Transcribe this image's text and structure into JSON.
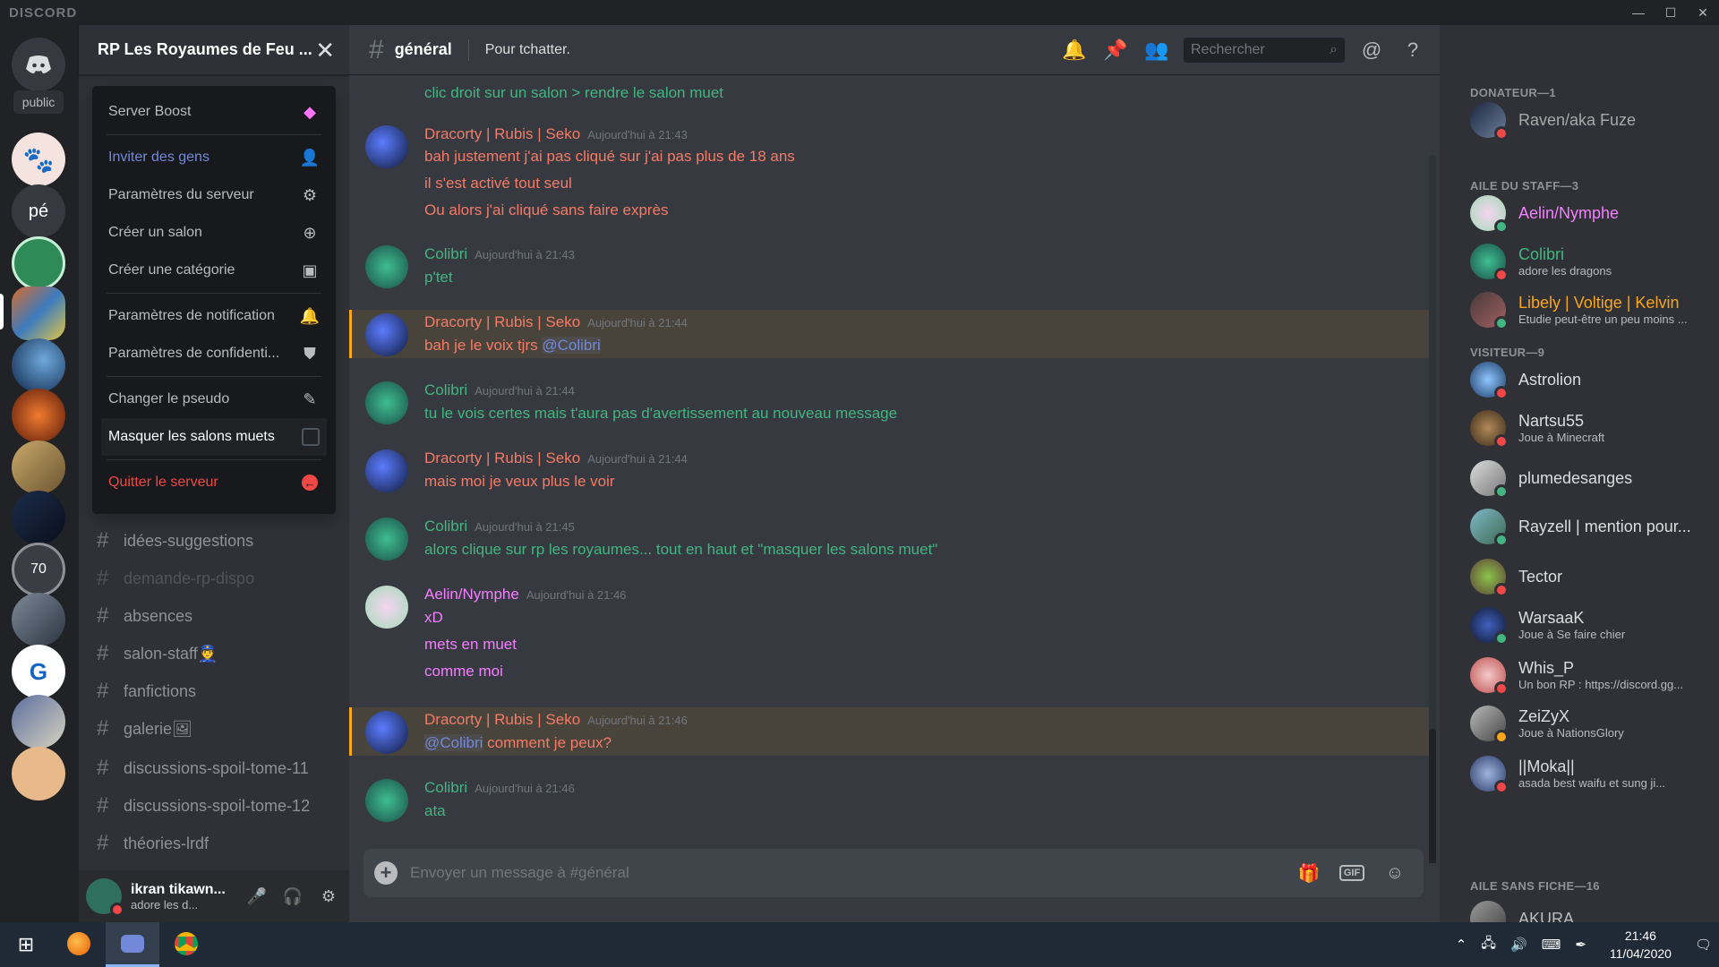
{
  "app": {
    "brand": "DISCORD"
  },
  "rail": {
    "folder_label": "public",
    "pe_label": "pé",
    "level_label": "70"
  },
  "guild": {
    "name": "RP Les Royaumes de Feu ..."
  },
  "menu": {
    "items": [
      {
        "label": "Server Boost",
        "icon": "boost-icon"
      },
      {
        "label": "Inviter des gens",
        "icon": "add-user-icon"
      },
      {
        "label": "Paramètres du serveur",
        "icon": "gear-icon"
      },
      {
        "label": "Créer un salon",
        "icon": "plus-circle-icon"
      },
      {
        "label": "Créer une catégorie",
        "icon": "folder-plus-icon"
      },
      {
        "label": "Paramètres de notification",
        "icon": "bell-icon"
      },
      {
        "label": "Paramètres de confidenti...",
        "icon": "shield-icon"
      },
      {
        "label": "Changer le pseudo",
        "icon": "pencil-icon"
      },
      {
        "label": "Masquer les salons muets",
        "icon": "checkbox-icon"
      },
      {
        "label": "Quitter le serveur",
        "icon": "leave-icon"
      }
    ]
  },
  "channels": [
    {
      "name": "idées-suggestions"
    },
    {
      "name": "demande-rp-dispo"
    },
    {
      "name": "absences"
    },
    {
      "name": "salon-staff👮"
    },
    {
      "name": "fanfictions"
    },
    {
      "name": "galerie🖼"
    },
    {
      "name": "discussions-spoil-tome-11"
    },
    {
      "name": "discussions-spoil-tome-12"
    },
    {
      "name": "théories-lrdf"
    }
  ],
  "user": {
    "name": "ikran tikawn...",
    "status": "adore les d..."
  },
  "chat": {
    "channel": "général",
    "topic": "Pour tchatter.",
    "search_placeholder": "Rechercher",
    "composer_placeholder": "Envoyer un message à #général",
    "gif_label": "GIF"
  },
  "messages": [
    {
      "author": "",
      "time": "",
      "lines": [
        "clic droit sur un salon > rendre le salon muet"
      ],
      "color": "#43b581"
    },
    {
      "author": "Dracorty | Rubis | Seko",
      "time": "Aujourd'hui à 21:43",
      "lines": [
        "bah justement j'ai pas cliqué sur j'ai pas plus de 18 ans",
        "il s'est activé tout seul",
        "Ou alors j'ai cliqué sans faire exprès"
      ],
      "color": "#f47b67"
    },
    {
      "author": "Colibri",
      "time": "Aujourd'hui à 21:43",
      "lines": [
        "p'tet"
      ],
      "color": "#43b581"
    },
    {
      "author": "Dracorty | Rubis | Seko",
      "time": "Aujourd'hui à 21:44",
      "lines_pre": "bah je le voix tjrs ",
      "mention": "@Colibri",
      "color": "#f47b67"
    },
    {
      "author": "Colibri",
      "time": "Aujourd'hui à 21:44",
      "lines": [
        "tu le vois certes mais t'aura pas d'avertissement au nouveau message"
      ],
      "color": "#43b581"
    },
    {
      "author": "Dracorty | Rubis | Seko",
      "time": "Aujourd'hui à 21:44",
      "lines": [
        "mais moi je veux plus le voir"
      ],
      "color": "#f47b67"
    },
    {
      "author": "Colibri",
      "time": "Aujourd'hui à 21:45",
      "lines": [
        "alors clique sur rp les royaumes... tout en haut et \"masquer les salons muet\""
      ],
      "color": "#43b581"
    },
    {
      "author": "Aelin/Nymphe",
      "time": "Aujourd'hui à 21:46",
      "lines": [
        "xD",
        "mets en muet",
        "comme moi"
      ],
      "color": "#f47fff"
    },
    {
      "author": "Dracorty | Rubis | Seko",
      "time": "Aujourd'hui à 21:46",
      "mention": "@Colibri",
      "lines_post": " comment je peux?",
      "color": "#f47b67"
    },
    {
      "author": "Colibri",
      "time": "Aujourd'hui à 21:46",
      "lines": [
        "ata"
      ],
      "color": "#43b581"
    }
  ],
  "members": {
    "groups": [
      "DONATEUR—1",
      "AILE DU STAFF—3",
      "VISITEUR—9",
      "AILE SANS FICHE—16"
    ],
    "list": [
      {
        "name": "Raven/aka Fuze",
        "activity": "",
        "color": "#a9a9a9",
        "status": "#f04747"
      },
      {
        "name": "Aelin/Nymphe",
        "activity": "",
        "color": "#f47fff",
        "status": "#43b581"
      },
      {
        "name": "Colibri",
        "activity": "adore les dragons",
        "color": "#43b581",
        "status": "#f04747"
      },
      {
        "name": "Libely | Voltige | Kelvin",
        "activity": "Etudie peut-être un peu moins ...",
        "color": "#faa61a",
        "status": "#43b581"
      },
      {
        "name": "Astrolion",
        "activity": "",
        "color": "#ffffff",
        "status": "#f04747"
      },
      {
        "name": "Nartsu55",
        "activity": "Joue à Minecraft",
        "color": "#ffffff",
        "status": "#f04747"
      },
      {
        "name": "plumedesanges",
        "activity": "",
        "color": "#ffffff",
        "status": "#43b581"
      },
      {
        "name": "Rayzell | mention pour...",
        "activity": "",
        "color": "#ffffff",
        "status": "#43b581"
      },
      {
        "name": "Tector",
        "activity": "",
        "color": "#ffffff",
        "status": "#f04747"
      },
      {
        "name": "WarsaaK",
        "activity": "Joue à Se faire chier",
        "color": "#ffffff",
        "status": "#43b581"
      },
      {
        "name": "Whis_P",
        "activity": "Un bon RP : https://discord.gg...",
        "color": "#ffffff",
        "status": "#f04747"
      },
      {
        "name": "ZeiZyX",
        "activity": "Joue à NationsGlory",
        "color": "#ffffff",
        "status": "#faa61a"
      },
      {
        "name": "||Moka||",
        "activity": "asada best waifu et sung ji...",
        "color": "#ffffff",
        "status": "#f04747"
      },
      {
        "name": "AKURA",
        "activity": "",
        "color": "#b9bbbe",
        "status": "#747f8d"
      }
    ]
  },
  "taskbar": {
    "time": "21:46",
    "date": "11/04/2020"
  }
}
